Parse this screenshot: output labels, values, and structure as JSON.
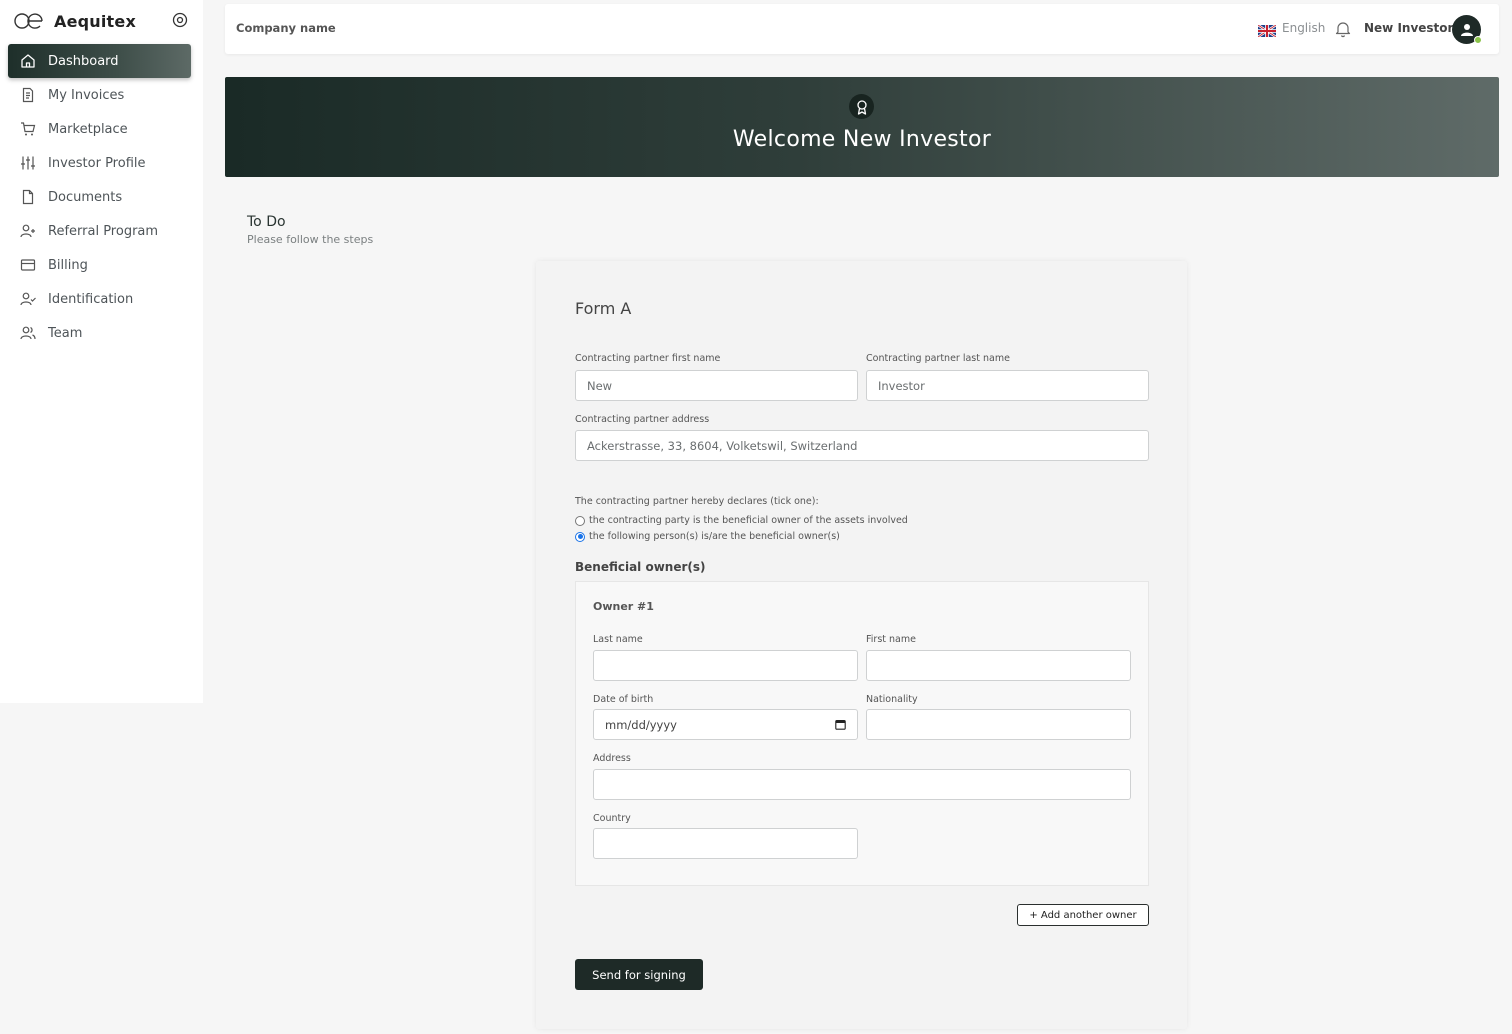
{
  "brand": {
    "name": "Aequitex",
    "logo_text": "Œ"
  },
  "sidebar": {
    "items": [
      {
        "label": "Dashboard",
        "icon": "home-icon",
        "active": true
      },
      {
        "label": "My Invoices",
        "icon": "invoice-icon"
      },
      {
        "label": "Marketplace",
        "icon": "cart-icon"
      },
      {
        "label": "Investor Profile",
        "icon": "sliders-icon"
      },
      {
        "label": "Documents",
        "icon": "document-icon"
      },
      {
        "label": "Referral Program",
        "icon": "user-plus-icon"
      },
      {
        "label": "Billing",
        "icon": "credit-card-icon"
      },
      {
        "label": "Identification",
        "icon": "user-check-icon"
      },
      {
        "label": "Team",
        "icon": "users-icon"
      }
    ]
  },
  "header": {
    "company": "Company name",
    "language": "English",
    "user_name": "New Investor"
  },
  "banner": {
    "title": "Welcome New Investor",
    "icon": "award-icon"
  },
  "todo": {
    "title": "To Do",
    "subtitle": "Please follow the steps"
  },
  "form": {
    "title": "Form A",
    "first_name_label": "Contracting partner first name",
    "first_name_value": "New",
    "last_name_label": "Contracting partner last name",
    "last_name_value": "Investor",
    "address_label": "Contracting partner address",
    "address_value": "Ackerstrasse, 33, 8604, Volketswil, Switzerland",
    "declare_label": "The contracting partner hereby declares (tick one):",
    "option_1": "the contracting party is the beneficial owner of the assets involved",
    "option_2": "the following person(s) is/are the beneficial owner(s)",
    "selected_option": 2,
    "beneficial_title": "Beneficial owner(s)",
    "owner": {
      "title": "Owner #1",
      "last_name_label": "Last name",
      "first_name_label": "First name",
      "dob_label": "Date of birth",
      "dob_placeholder": "mm/dd/yyyy",
      "nationality_label": "Nationality",
      "address_label": "Address",
      "country_label": "Country"
    },
    "add_owner_label": "+ Add another owner",
    "submit_label": "Send for signing"
  }
}
